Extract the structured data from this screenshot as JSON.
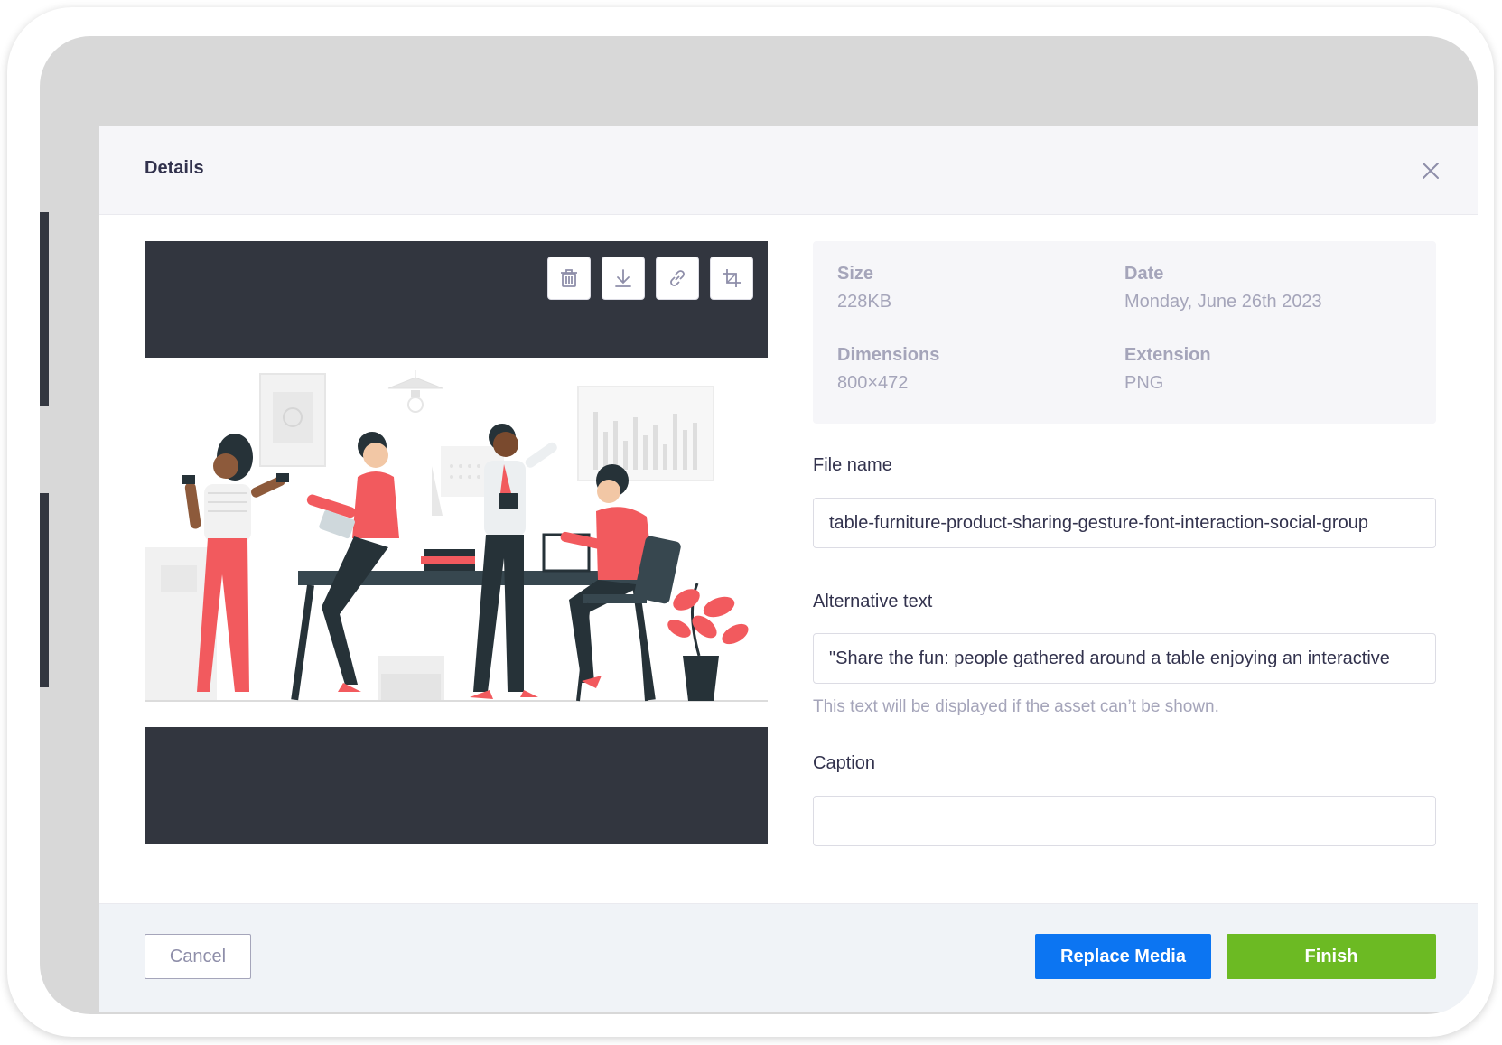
{
  "modal": {
    "title": "Details",
    "close_icon": "close-icon"
  },
  "toolbar": {
    "icons": [
      "trash-icon",
      "download-icon",
      "link-icon",
      "crop-icon"
    ]
  },
  "file_info": {
    "size_label": "Size",
    "size_value": "228KB",
    "date_label": "Date",
    "date_value": "Monday, June 26th 2023",
    "dimensions_label": "Dimensions",
    "dimensions_value": "800×472",
    "extension_label": "Extension",
    "extension_value": "PNG"
  },
  "form": {
    "file_name_label": "File name",
    "file_name_value": "table-furniture-product-sharing-gesture-font-interaction-social-group",
    "alt_text_label": "Alternative text",
    "alt_text_value": "\"Share the fun: people gathered around a table enjoying an interactive",
    "alt_text_hint": "This text will be displayed if the asset can’t be shown.",
    "caption_label": "Caption",
    "caption_value": ""
  },
  "footer": {
    "cancel_label": "Cancel",
    "replace_label": "Replace Media",
    "finish_label": "Finish"
  },
  "colors": {
    "primary": "#0c75f2",
    "success": "#6cba23",
    "preview_bg": "#32363f",
    "accent_red": "#f25a5e"
  }
}
